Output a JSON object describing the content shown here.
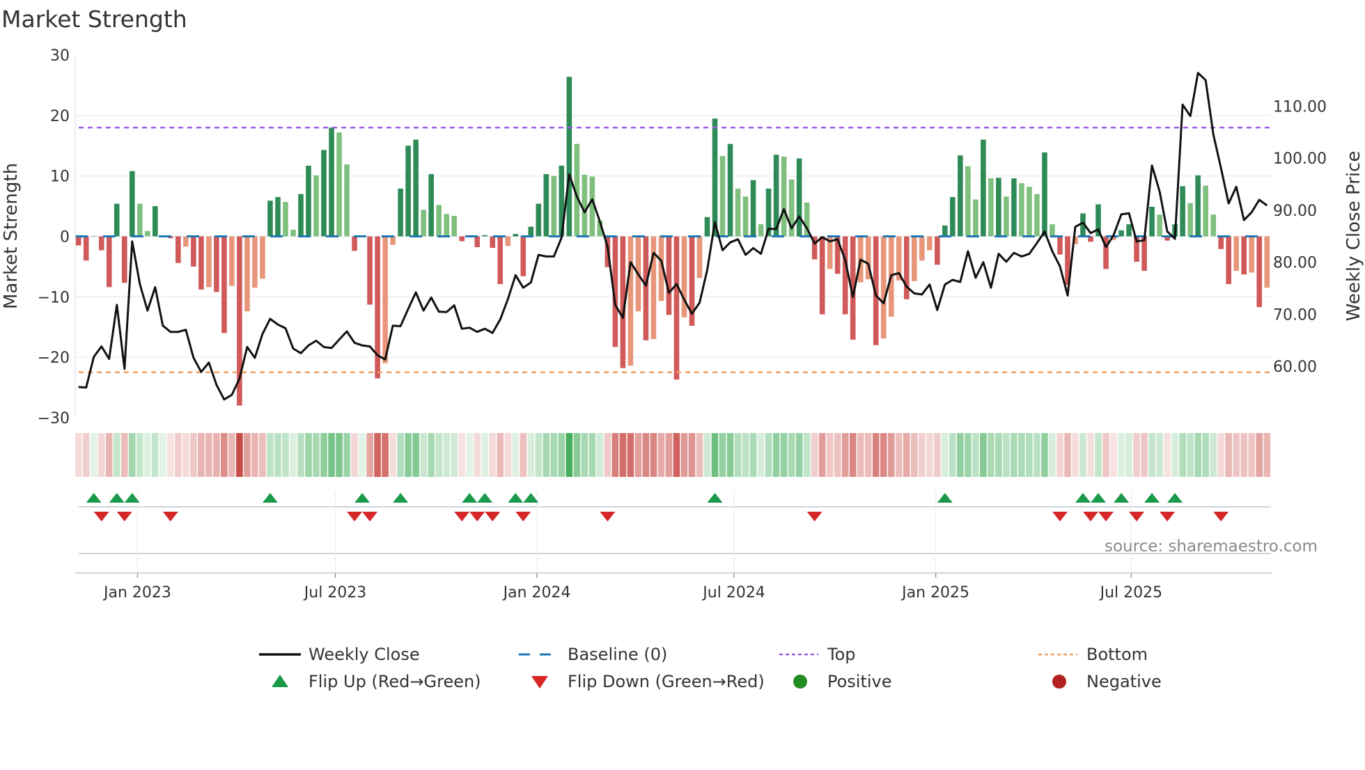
{
  "title": "Market Strength",
  "source": "source: sharemaestro.com",
  "colors": {
    "up_rising": "#2e8b57",
    "up_falling": "#7fc07f",
    "down_falling": "#d05a5a",
    "down_rising": "#e8967a",
    "close_line": "#111111",
    "baseline": "#1f77b4",
    "top": "#9b5de5",
    "bottom": "#f0a060",
    "flip_up": "#1a9a4a",
    "flip_down": "#d62728",
    "positive": "#228b22",
    "negative": "#b22222"
  },
  "chart_data": {
    "type": "bar",
    "title": "Market Strength",
    "ylabel": "Market Strength",
    "y2label": "Weekly Close Price",
    "ylim": [
      -30,
      30
    ],
    "y2lim": [
      49.5,
      119.5
    ],
    "frequency": "weekly",
    "left_ticks": [
      {
        "value": 30,
        "label": "30"
      },
      {
        "value": 20,
        "label": "20"
      },
      {
        "value": 10,
        "label": "10"
      },
      {
        "value": 0,
        "label": "0"
      },
      {
        "value": -10,
        "label": "−10"
      },
      {
        "value": -20,
        "label": "−20"
      },
      {
        "value": -30,
        "label": "−30"
      }
    ],
    "right_ticks": [
      {
        "value": 110,
        "label": "110.00"
      },
      {
        "value": 100,
        "label": "100.00"
      },
      {
        "value": 90,
        "label": "90.00"
      },
      {
        "value": 80,
        "label": "80.00"
      },
      {
        "value": 70,
        "label": "70.00"
      },
      {
        "value": 60,
        "label": "60.00"
      }
    ],
    "x_ticks": [
      {
        "week": 7.7,
        "label": "Jan 2023"
      },
      {
        "week": 33.5,
        "label": "Jul 2023"
      },
      {
        "week": 59.8,
        "label": "Jan 2024"
      },
      {
        "week": 85.5,
        "label": "Jul 2024"
      },
      {
        "week": 111.8,
        "label": "Jan 2025"
      },
      {
        "week": 137.3,
        "label": "Jul 2025"
      }
    ],
    "top_level": 18,
    "bottom_level": -22.5,
    "baseline": 0,
    "strength": [
      -1.5,
      -4,
      0,
      -2.3,
      -8.4,
      5.4,
      -7.7,
      10.8,
      5.4,
      0.9,
      5.0,
      0,
      -0.3,
      -4.4,
      -1.7,
      -5,
      -8.8,
      -8.4,
      -9.2,
      -16,
      -8.2,
      -28,
      -12.4,
      -8.5,
      -7,
      5.9,
      6.5,
      5.7,
      1.1,
      7,
      11.7,
      10.1,
      14.3,
      18,
      17.2,
      11.9,
      -2.4,
      0,
      -11.3,
      -23.5,
      -21,
      -1.4,
      7.9,
      15,
      16,
      4.4,
      10.3,
      5.2,
      3.7,
      3.4,
      -0.8,
      0,
      -1.8,
      0.2,
      -1.9,
      -7.9,
      -1.6,
      0.4,
      -6.6,
      1.6,
      5.4,
      10.3,
      10,
      11.7,
      26.4,
      15.3,
      10.2,
      9.9,
      2.6,
      -5.1,
      -18.3,
      -21.8,
      -21.4,
      -12.4,
      -17.2,
      -17,
      -10.7,
      -13,
      -23.7,
      -13.4,
      -14.8,
      -6.9,
      3.2,
      19.5,
      13.3,
      15.3,
      7.9,
      6.6,
      9.3,
      2,
      7.9,
      13.5,
      13.2,
      9.4,
      12.9,
      5.6,
      -3.8,
      -12.9,
      -5.4,
      -6.2,
      -12.9,
      -17.1,
      -7.6,
      -7.1,
      -18,
      -16.9,
      -13.3,
      -7.3,
      -10.4,
      -7.4,
      -4,
      -2.3,
      -4.7,
      1.8,
      6.5,
      13.4,
      11.6,
      6.1,
      16,
      9.6,
      9.7,
      6.6,
      9.6,
      8.8,
      8.2,
      7,
      13.9,
      2,
      -3,
      -8,
      -1.3,
      3.8,
      -0.9,
      5.3,
      -5.4,
      -0.6,
      1,
      2,
      -4.2,
      -5.7,
      4.9,
      3.6,
      -0.7,
      2,
      8.3,
      5.5,
      10.1,
      8.4,
      3.6,
      -2.1,
      -7.9,
      -5.7,
      -6.3,
      -6,
      -11.7,
      -8.5
    ],
    "weekly_close": [
      56.0,
      55.9,
      61.8,
      63.8,
      61.4,
      71.8,
      59.5,
      84.0,
      75.8,
      70.7,
      75.2,
      67.8,
      66.6,
      66.6,
      67.0,
      61.6,
      58.9,
      60.7,
      56.4,
      53.6,
      54.5,
      57.6,
      63.7,
      61.6,
      66.2,
      69.1,
      68.0,
      67.3,
      63.4,
      62.5,
      64.0,
      64.9,
      63.7,
      63.5,
      65.1,
      66.7,
      64.5,
      64.0,
      63.8,
      62.1,
      61.3,
      67.8,
      67.7,
      71.0,
      74.2,
      70.7,
      73.2,
      70.5,
      70.4,
      71.7,
      67.2,
      67.4,
      66.6,
      67.2,
      66.4,
      69.0,
      72.9,
      77.5,
      75.1,
      76.1,
      81.4,
      81.1,
      81.1,
      84.7,
      96.9,
      92.6,
      89.6,
      92.1,
      87.8,
      83.0,
      71.8,
      69.3,
      80.0,
      77.7,
      75.5,
      81.8,
      80.3,
      74.1,
      75.8,
      72.8,
      70.1,
      72.2,
      78.5,
      87.7,
      82.3,
      83.8,
      84.4,
      81.4,
      82.7,
      81.6,
      86.4,
      86.4,
      90.2,
      86.5,
      88.8,
      86.5,
      83.6,
      84.8,
      84.0,
      84.4,
      80.4,
      73.3,
      80.5,
      79.7,
      73.6,
      72.1,
      77.5,
      77.9,
      75.3,
      74.0,
      73.8,
      75.7,
      70.8,
      75.7,
      76.6,
      76.2,
      82.1,
      77.0,
      80.0,
      75.1,
      81.6,
      80.1,
      81.8,
      81.1,
      81.6,
      83.7,
      85.9,
      82.1,
      79.2,
      73.6,
      86.8,
      87.6,
      85.6,
      86.3,
      82.9,
      85.2,
      89.2,
      89.4,
      84.0,
      84.2,
      98.6,
      93.6,
      85.9,
      84.5,
      110.3,
      108.1,
      116.4,
      115.0,
      104.6,
      98.1,
      91.3,
      94.5,
      88.1,
      89.6,
      92.0,
      90.9
    ],
    "flip_up_weeks": [
      2,
      5,
      7,
      25,
      37,
      42,
      51,
      53,
      57,
      59,
      83,
      113,
      131,
      133,
      136,
      140,
      143
    ],
    "flip_down_weeks": [
      3,
      6,
      12,
      36,
      38,
      50,
      52,
      54,
      58,
      69,
      96,
      128,
      132,
      134,
      138,
      142,
      149
    ],
    "legend": [
      {
        "label": "Weekly Close",
        "symbol": "line"
      },
      {
        "label": "Baseline (0)",
        "symbol": "dashed"
      },
      {
        "label": "Top",
        "symbol": "dotted-purple"
      },
      {
        "label": "Bottom",
        "symbol": "dotted-orange"
      },
      {
        "label": "Flip Up (Red→Green)",
        "symbol": "triangle-up"
      },
      {
        "label": "Flip Down (Green→Red)",
        "symbol": "triangle-down"
      },
      {
        "label": "Positive",
        "symbol": "circle-green"
      },
      {
        "label": "Negative",
        "symbol": "circle-red"
      }
    ],
    "legend_position": "bottom"
  }
}
